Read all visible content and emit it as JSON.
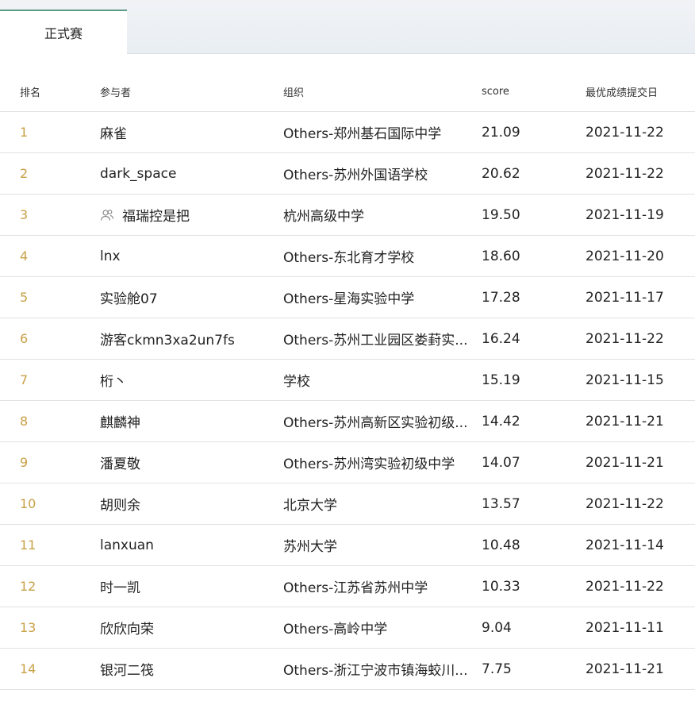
{
  "tabs": [
    {
      "label": "正式赛",
      "active": true
    }
  ],
  "columns": {
    "rank": "排名",
    "participant": "参与者",
    "organization": "组织",
    "score": "score",
    "best_date": "最优成绩提交日"
  },
  "rows": [
    {
      "rank": "1",
      "name": "麻雀",
      "team": false,
      "org": "Others-郑州基石国际中学",
      "score": "21.09",
      "date": "2021-11-22"
    },
    {
      "rank": "2",
      "name": "dark_space",
      "team": false,
      "org": "Others-苏州外国语学校",
      "score": "20.62",
      "date": "2021-11-22"
    },
    {
      "rank": "3",
      "name": "福瑞控是把",
      "team": true,
      "org": "杭州高级中学",
      "score": "19.50",
      "date": "2021-11-19"
    },
    {
      "rank": "4",
      "name": "lnx",
      "team": false,
      "org": "Others-东北育才学校",
      "score": "18.60",
      "date": "2021-11-20"
    },
    {
      "rank": "5",
      "name": "实验舱07",
      "team": false,
      "org": "Others-星海实验中学",
      "score": "17.28",
      "date": "2021-11-17"
    },
    {
      "rank": "6",
      "name": "游客ckmn3xa2un7fs",
      "team": false,
      "org": "Others-苏州工业园区娄葑实...",
      "score": "16.24",
      "date": "2021-11-22"
    },
    {
      "rank": "7",
      "name": "桁丶",
      "team": false,
      "org": "学校",
      "score": "15.19",
      "date": "2021-11-15"
    },
    {
      "rank": "8",
      "name": "麒麟神",
      "team": false,
      "org": "Others-苏州高新区实验初级...",
      "score": "14.42",
      "date": "2021-11-21"
    },
    {
      "rank": "9",
      "name": "潘夏敬",
      "team": false,
      "org": "Others-苏州湾实验初级中学",
      "score": "14.07",
      "date": "2021-11-21"
    },
    {
      "rank": "10",
      "name": "胡则余",
      "team": false,
      "org": "北京大学",
      "score": "13.57",
      "date": "2021-11-22"
    },
    {
      "rank": "11",
      "name": "lanxuan",
      "team": false,
      "org": "苏州大学",
      "score": "10.48",
      "date": "2021-11-14"
    },
    {
      "rank": "12",
      "name": "时一凯",
      "team": false,
      "org": "Others-江苏省苏州中学",
      "score": "10.33",
      "date": "2021-11-22"
    },
    {
      "rank": "13",
      "name": "欣欣向荣",
      "team": false,
      "org": "Others-高岭中学",
      "score": "9.04",
      "date": "2021-11-11"
    },
    {
      "rank": "14",
      "name": "银河二筏",
      "team": false,
      "org": "Others-浙江宁波市镇海蛟川...",
      "score": "7.75",
      "date": "2021-11-21"
    }
  ],
  "colors": {
    "rank": "#c9a046",
    "tab_accent": "#5a9b82",
    "divider": "#e2e2e2"
  },
  "icons": {
    "team": "team-users-icon"
  }
}
